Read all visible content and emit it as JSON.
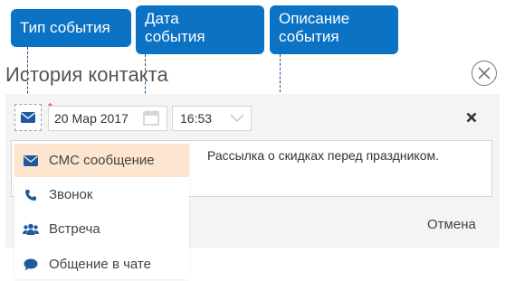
{
  "callouts": {
    "event_type": "Тип события",
    "event_date_line1": "Дата",
    "event_date_line2": "события",
    "description_line1": "Описание",
    "description_line2": "события"
  },
  "dialog": {
    "title": "История контакта",
    "date_value": "20 Мар 2017",
    "time_value": "16:53",
    "description_text": "Рассылка о скидках перед праздником.",
    "cancel_label": "Отмена",
    "required_mark": "*"
  },
  "type_menu": {
    "items": [
      {
        "label": "СМС сообщение",
        "icon": "envelope-icon",
        "selected": true
      },
      {
        "label": "Звонок",
        "icon": "phone-icon",
        "selected": false
      },
      {
        "label": "Встреча",
        "icon": "people-icon",
        "selected": false
      },
      {
        "label": "Общение в чате",
        "icon": "chat-icon",
        "selected": false
      }
    ]
  },
  "colors": {
    "callout_bg": "#0b72c4",
    "selected_item_bg": "#fde5cf",
    "icon_blue": "#1f5a9e",
    "required_red": "#e02020"
  }
}
